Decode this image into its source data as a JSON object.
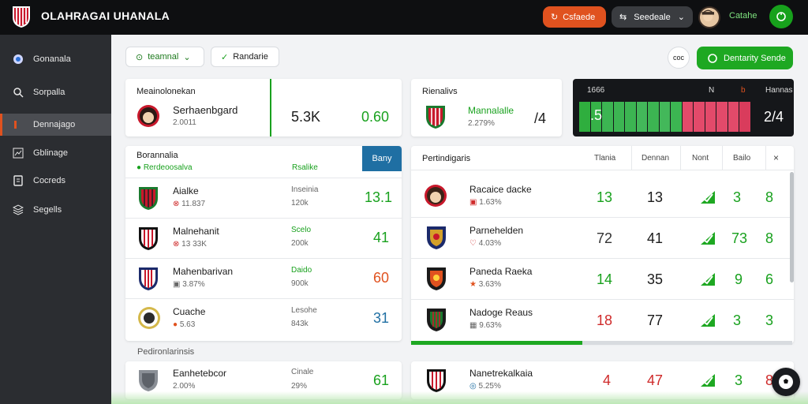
{
  "app": {
    "title": "OLAHRAGAI UHANALA"
  },
  "header": {
    "orange_button": "Csfaede",
    "dark_button": "Seedeale",
    "user_name": "Catahe"
  },
  "sidebar": {
    "items": [
      {
        "label": "Gonanala",
        "icon": "circle-icon"
      },
      {
        "label": "Sorpalla",
        "icon": "search-icon"
      },
      {
        "label": "Dennajago",
        "icon": "bar-icon"
      },
      {
        "label": "Gblinage",
        "icon": "chart-icon"
      },
      {
        "label": "Cocreds",
        "icon": "card-icon"
      },
      {
        "label": "Segells",
        "icon": "stack-icon"
      }
    ]
  },
  "filters": {
    "chip1": "teamnal",
    "chip2": "Randarie",
    "circle_chip": "coc",
    "cta": "Dentarity Sende"
  },
  "kpi1": {
    "title": "Meainolonekan",
    "name": "Serhaenbgard",
    "sub": "2.0011",
    "val1": "5.3K",
    "val2": "0.60"
  },
  "kpi2": {
    "title": "Rienalivs",
    "name": "Mannalalle",
    "sub": "2.279%",
    "val": "/4"
  },
  "kpi3": {
    "col1": "1666",
    "col2": "N",
    "col3": "b",
    "col4": "Hannas",
    "val1": ".5",
    "val2": "2/4"
  },
  "left_panel": {
    "title": "Borannalia",
    "subtitle": "Rerdeoosalva",
    "col": "Rsalike",
    "tab": "Bany",
    "rows": [
      {
        "name": "Aialke",
        "sub": "11.837",
        "mid": "Inseinia",
        "mid_sub": "120k",
        "value": "13.1",
        "color": "#19a11e"
      },
      {
        "name": "Malnehanit",
        "sub": "13 33K",
        "mid": "Scelo",
        "mid_sub": "200k",
        "value": "41",
        "color": "#19a11e"
      },
      {
        "name": "Mahenbarivan",
        "sub": "3.87%",
        "mid": "Daido",
        "mid_sub": "900k",
        "value": "60",
        "color": "#e0521f"
      },
      {
        "name": "Cuache",
        "sub": "5.63",
        "mid": "Lesohe",
        "mid_sub": "843k",
        "value": "31",
        "color": "#1f6fa3"
      }
    ],
    "section": "Pedironlarinsis",
    "footer_row": {
      "name": "Eanhetebcor",
      "sub": "2.00%",
      "mid": "Cinale",
      "mid_sub": "29%",
      "value": "61",
      "color": "#19a11e"
    }
  },
  "right_panel": {
    "title": "Pertindigaris",
    "headers": [
      "Tlania",
      "Dennan",
      "Nont",
      "Bailo"
    ],
    "rows": [
      {
        "name": "Racaice dacke",
        "sub": "1.63%",
        "c1": "13",
        "c2": "13",
        "c3": "3",
        "c4": "8",
        "c1color": "#19a11e"
      },
      {
        "name": "Parnehelden",
        "sub": "4.03%",
        "c1": "72",
        "c2": "41",
        "c3": "73",
        "c4": "8",
        "c1color": "#333333"
      },
      {
        "name": "Paneda Raeka",
        "sub": "3.63%",
        "c1": "14",
        "c2": "35",
        "c3": "9",
        "c4": "6",
        "c1color": "#19a11e"
      },
      {
        "name": "Nadoge Reaus",
        "sub": "9.63%",
        "c1": "18",
        "c2": "77",
        "c3": "3",
        "c4": "3",
        "c1color": "#cf2a2a"
      }
    ],
    "footer_row": {
      "name": "Nanetrekalkaia",
      "sub": "5.25%",
      "c1": "4",
      "c2": "47",
      "c3": "3",
      "c4": "8"
    },
    "progress": 0.45
  }
}
